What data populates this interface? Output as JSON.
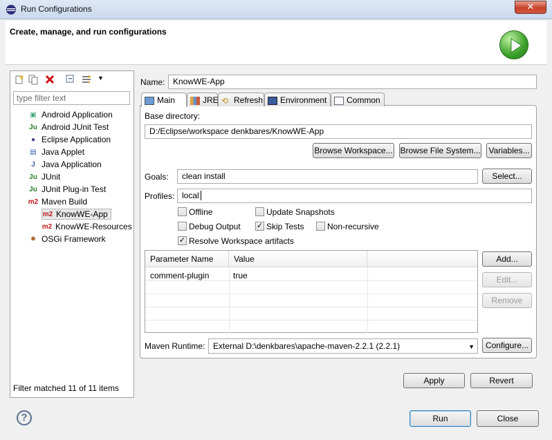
{
  "window": {
    "title": "Run Configurations",
    "close_glyph": "✕"
  },
  "header": {
    "title": "Create, manage, and run configurations",
    "run_icon": "run-play-icon"
  },
  "left": {
    "filter_placeholder": "type filter text",
    "items": [
      {
        "label": "Android Application",
        "icon": "android-app-icon",
        "glyph": "▣",
        "color": "#4a7"
      },
      {
        "label": "Android JUnit Test",
        "icon": "junit-icon",
        "glyph": "Ju",
        "color": "#2a7a2a"
      },
      {
        "label": "Eclipse Application",
        "icon": "eclipse-icon",
        "glyph": "●",
        "color": "#3b3d8a"
      },
      {
        "label": "Java Applet",
        "icon": "applet-icon",
        "glyph": "▤",
        "color": "#3a5fa8"
      },
      {
        "label": "Java Application",
        "icon": "java-app-icon",
        "glyph": "J",
        "color": "#3a5fa8"
      },
      {
        "label": "JUnit",
        "icon": "junit-icon",
        "glyph": "Ju",
        "color": "#2a7a2a"
      },
      {
        "label": "JUnit Plug-in Test",
        "icon": "junit-plugin-icon",
        "glyph": "Ju",
        "color": "#2a7a2a"
      },
      {
        "label": "Maven Build",
        "icon": "maven-icon",
        "glyph": "m2",
        "color": "#c0161b"
      },
      {
        "label": "KnowWE-App",
        "icon": "maven-icon",
        "glyph": "m2",
        "color": "#c0161b"
      },
      {
        "label": "KnowWE-Resources",
        "icon": "maven-icon",
        "glyph": "m2",
        "color": "#c0161b"
      },
      {
        "label": "OSGi Framework",
        "icon": "osgi-icon",
        "glyph": "✹",
        "color": "#b0642a"
      }
    ],
    "status": "Filter matched 11 of 11 items"
  },
  "form": {
    "name_label": "Name:",
    "name_value": "KnowWE-App",
    "tabs": [
      "Main",
      "JRE",
      "Refresh",
      "Environment",
      "Common"
    ],
    "base_dir_label": "Base directory:",
    "base_dir_value": "D:/Eclipse/workspace denkbares/KnowWE-App",
    "browse_workspace": "Browse Workspace...",
    "browse_fs": "Browse File System...",
    "variables": "Variables...",
    "goals_label": "Goals:",
    "goals_value": "clean install",
    "select": "Select...",
    "profiles_label": "Profiles:",
    "profiles_value": "local",
    "checks": {
      "offline": {
        "label": "Offline",
        "checked": false
      },
      "update_snapshots": {
        "label": "Update Snapshots",
        "checked": false
      },
      "debug_output": {
        "label": "Debug Output",
        "checked": false
      },
      "skip_tests": {
        "label": "Skip Tests",
        "checked": true
      },
      "non_recursive": {
        "label": "Non-recursive",
        "checked": false
      },
      "resolve_ws": {
        "label": "Resolve Workspace artifacts",
        "checked": true
      }
    },
    "table": {
      "headers": [
        "Parameter Name",
        "Value"
      ],
      "rows": [
        [
          "comment-plugin",
          "true"
        ]
      ]
    },
    "add": "Add...",
    "edit": "Edit...",
    "remove": "Remove",
    "runtime_label": "Maven Runtime:",
    "runtime_value": "External D:\\denkbares\\apache-maven-2.2.1 (2.2.1)",
    "configure": "Configure...",
    "apply": "Apply",
    "revert": "Revert"
  },
  "footer": {
    "help_glyph": "?",
    "run": "Run",
    "close": "Close"
  }
}
